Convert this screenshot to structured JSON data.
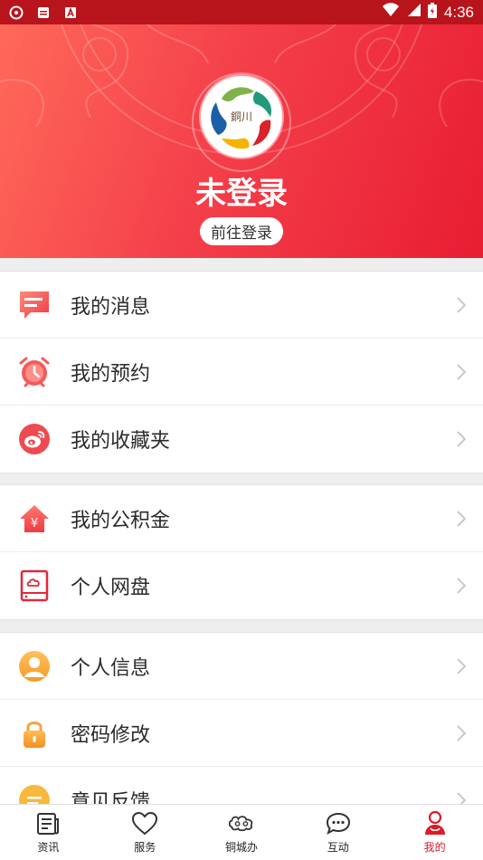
{
  "status_bar": {
    "time": "4:36"
  },
  "header": {
    "title": "未登录",
    "login_label": "前往登录",
    "logo_text": "銅川"
  },
  "menu_groups": [
    {
      "items": [
        {
          "label": "我的消息",
          "icon": "message-icon"
        },
        {
          "label": "我的预约",
          "icon": "alarm-clock-icon"
        },
        {
          "label": "我的收藏夹",
          "icon": "weibo-icon"
        }
      ]
    },
    {
      "items": [
        {
          "label": "我的公积金",
          "icon": "house-yuan-icon"
        },
        {
          "label": "个人网盘",
          "icon": "cloud-disk-icon"
        }
      ]
    },
    {
      "items": [
        {
          "label": "个人信息",
          "icon": "user-icon"
        },
        {
          "label": "密码修改",
          "icon": "lock-icon"
        },
        {
          "label": "意见反馈",
          "icon": "feedback-icon"
        }
      ]
    }
  ],
  "tabbar": {
    "tabs": [
      {
        "label": "资讯",
        "icon": "news-icon"
      },
      {
        "label": "服务",
        "icon": "heart-icon"
      },
      {
        "label": "铜城办",
        "icon": "cloud-icon"
      },
      {
        "label": "互动",
        "icon": "chat-icon"
      },
      {
        "label": "我的",
        "icon": "profile-icon",
        "active": true
      }
    ]
  },
  "colors": {
    "accent": "#e81d33",
    "header_start": "#ff6b5a",
    "status_bar": "#b8141c"
  }
}
